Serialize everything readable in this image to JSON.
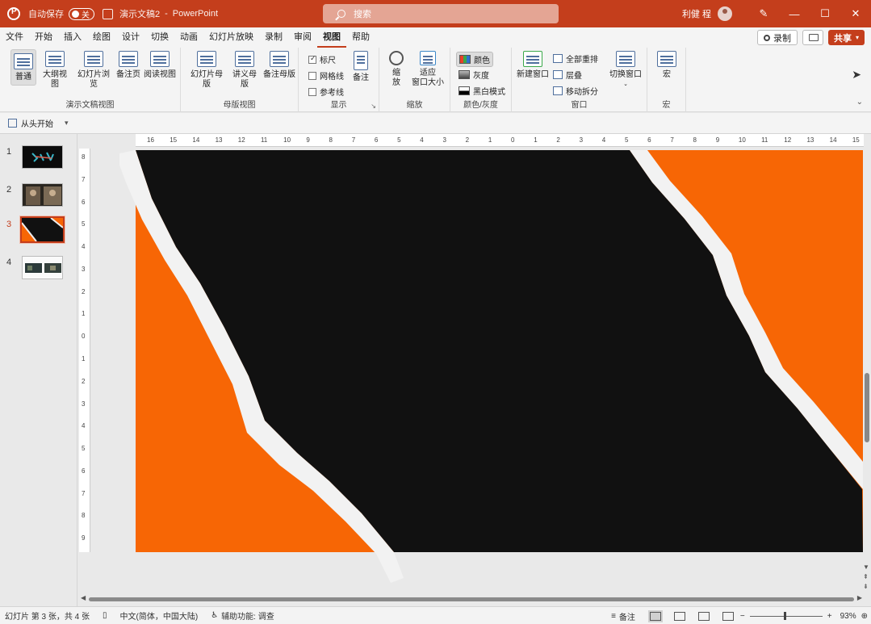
{
  "titlebar": {
    "autosave_label": "自动保存",
    "autosave_state": "关",
    "doc_title": "演示文稿2",
    "app_name": "PowerPoint",
    "search_placeholder": "搜索",
    "user_name": "利健 程",
    "accent_color": "#c43e1c"
  },
  "menu": {
    "tabs": [
      "文件",
      "开始",
      "插入",
      "绘图",
      "设计",
      "切换",
      "动画",
      "幻灯片放映",
      "录制",
      "审阅",
      "视图",
      "帮助"
    ],
    "active_tab": "视图",
    "record_label": "录制",
    "share_label": "共享"
  },
  "ribbon": {
    "presentation_views": {
      "title": "演示文稿视图",
      "normal": "普通",
      "outline": "大纲视图",
      "sorter": "幻灯片浏览",
      "notes_page": "备注页",
      "reading": "阅读视图"
    },
    "master_views": {
      "title": "母版视图",
      "slide_master": "幻灯片母版",
      "handout_master": "讲义母版",
      "notes_master": "备注母版"
    },
    "show": {
      "title": "显示",
      "ruler": "标尺",
      "ruler_checked": true,
      "gridlines": "网格线",
      "guides": "参考线",
      "notes": "备注"
    },
    "zoom": {
      "title": "缩放",
      "zoom_line1": "缩",
      "zoom_line2": "放",
      "fit_line1": "适应",
      "fit_line2": "窗口大小"
    },
    "color": {
      "title": "颜色/灰度",
      "color": "颜色",
      "grayscale": "灰度",
      "bw": "黑白模式"
    },
    "window": {
      "title": "窗口",
      "new_window": "新建窗口",
      "arrange_all": "全部重排",
      "cascade": "层叠",
      "move_split": "移动拆分",
      "switch_window": "切换窗口"
    },
    "macros": {
      "title": "宏",
      "macros": "宏"
    }
  },
  "qat": {
    "from_beginning": "从头开始"
  },
  "thumbnails": {
    "numbers": [
      "1",
      "2",
      "3",
      "4"
    ],
    "selected": "3"
  },
  "ruler": {
    "horizontal": [
      "16",
      "15",
      "14",
      "13",
      "12",
      "11",
      "10",
      "9",
      "8",
      "7",
      "6",
      "5",
      "4",
      "3",
      "2",
      "1",
      "0",
      "1",
      "2",
      "3",
      "4",
      "5",
      "6",
      "7",
      "8",
      "9",
      "10",
      "11",
      "12",
      "13",
      "14",
      "15"
    ],
    "vertical": [
      "8",
      "7",
      "6",
      "5",
      "4",
      "3",
      "2",
      "1",
      "0",
      "1",
      "2",
      "3",
      "4",
      "5",
      "6",
      "7",
      "8",
      "9"
    ]
  },
  "slide": {
    "colors": {
      "orange": "#f76605",
      "black": "#111111",
      "paper": "#f2f2f2"
    }
  },
  "statusbar": {
    "slide_info": "幻灯片 第 3 张，共 4 张",
    "language": "中文(简体，中国大陆)",
    "accessibility": "辅助功能: 调查",
    "notes": "备注",
    "zoom_minus": "−",
    "zoom_plus": "+",
    "zoom_level": "93%"
  }
}
